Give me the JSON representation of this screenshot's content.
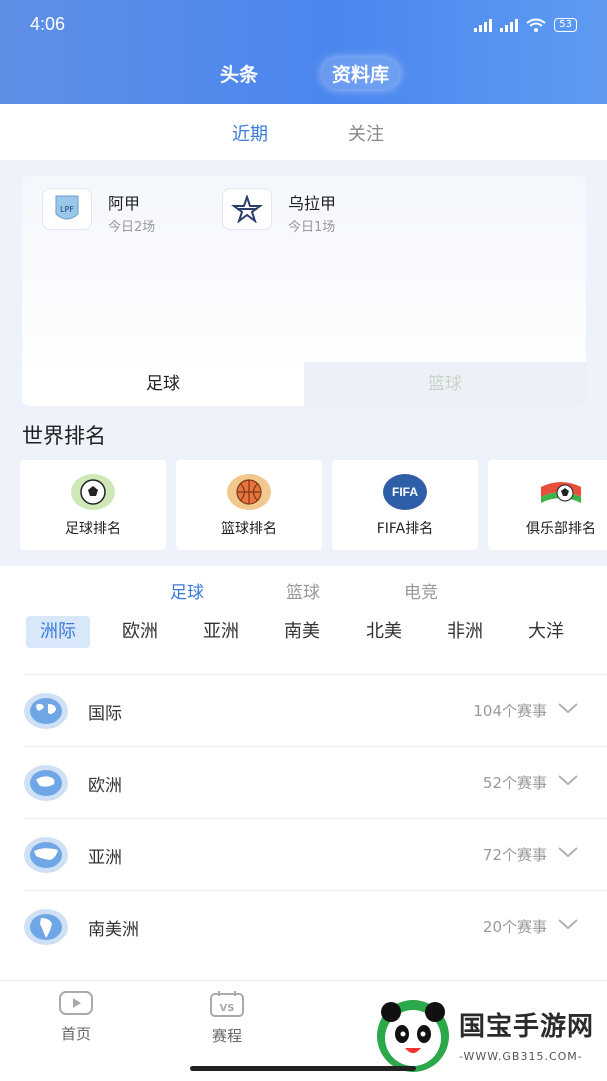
{
  "status_bar": {
    "time": "4:06",
    "battery": "53"
  },
  "top_tabs": {
    "items": [
      "头条",
      "资料库"
    ],
    "active": "资料库"
  },
  "sub_tabs": {
    "items": [
      "近期",
      "关注"
    ],
    "active": "近期"
  },
  "leagues": [
    {
      "name": "阿甲",
      "sub": "今日2场",
      "logo_text": "LPF"
    },
    {
      "name": "乌拉甲",
      "sub": "今日1场"
    }
  ],
  "sport_tabs": {
    "items": [
      "足球",
      "篮球"
    ],
    "active": "足球"
  },
  "world_rank": {
    "title": "世界排名",
    "items": [
      {
        "label": "足球排名",
        "icon": "soccer-ball-icon",
        "color": "#cfe8b8"
      },
      {
        "label": "篮球排名",
        "icon": "basketball-icon",
        "color": "#f2c88e"
      },
      {
        "label": "FIFA排名",
        "icon": "fifa-icon",
        "color": "#2f5ea8",
        "icon_text": "FIFA"
      },
      {
        "label": "俱乐部排名",
        "icon": "club-flag-icon",
        "color": "#ffffff"
      }
    ]
  },
  "categories": {
    "items": [
      "足球",
      "篮球",
      "电竞"
    ],
    "active": "足球"
  },
  "regions": {
    "items": [
      "洲际",
      "欧洲",
      "亚洲",
      "南美",
      "北美",
      "非洲",
      "大洋"
    ],
    "active": "洲际"
  },
  "continents": [
    {
      "name": "国际",
      "count": "104个赛事"
    },
    {
      "name": "欧洲",
      "count": "52个赛事"
    },
    {
      "name": "亚洲",
      "count": "72个赛事"
    },
    {
      "name": "南美洲",
      "count": "20个赛事"
    }
  ],
  "bottom_nav": [
    {
      "label": "首页",
      "icon": "play-icon"
    },
    {
      "label": "赛程",
      "icon": "vs-icon",
      "icon_text": "VS"
    }
  ],
  "watermark": {
    "title": "国宝手游网",
    "sub": "-WWW.GB315.COM-"
  },
  "colors": {
    "accent": "#3a7ad8",
    "header": "#4a86ee"
  }
}
